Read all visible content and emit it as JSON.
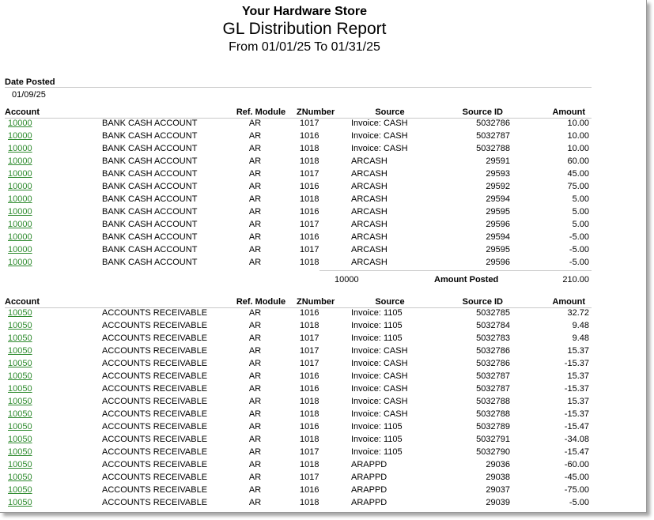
{
  "report": {
    "store_name": "Your Hardware Store",
    "title": "GL Distribution Report",
    "date_range": "From 01/01/25 To 01/31/25"
  },
  "date_posted": {
    "label": "Date Posted",
    "value": "01/09/25"
  },
  "columns": {
    "account": "Account",
    "ref_module": "Ref. Module",
    "znumber": "ZNumber",
    "source": "Source",
    "source_id": "Source ID",
    "amount": "Amount"
  },
  "sections": [
    {
      "rows": [
        {
          "account": "10000",
          "name": "BANK CASH ACCOUNT",
          "module": "AR",
          "znumber": "1017",
          "source": "Invoice: CASH",
          "source_id": "5032786",
          "amount": "10.00"
        },
        {
          "account": "10000",
          "name": "BANK CASH ACCOUNT",
          "module": "AR",
          "znumber": "1016",
          "source": "Invoice: CASH",
          "source_id": "5032787",
          "amount": "10.00"
        },
        {
          "account": "10000",
          "name": "BANK CASH ACCOUNT",
          "module": "AR",
          "znumber": "1018",
          "source": "Invoice: CASH",
          "source_id": "5032788",
          "amount": "10.00"
        },
        {
          "account": "10000",
          "name": "BANK CASH ACCOUNT",
          "module": "AR",
          "znumber": "1018",
          "source": "ARCASH",
          "source_id": "29591",
          "amount": "60.00"
        },
        {
          "account": "10000",
          "name": "BANK CASH ACCOUNT",
          "module": "AR",
          "znumber": "1017",
          "source": "ARCASH",
          "source_id": "29593",
          "amount": "45.00"
        },
        {
          "account": "10000",
          "name": "BANK CASH ACCOUNT",
          "module": "AR",
          "znumber": "1016",
          "source": "ARCASH",
          "source_id": "29592",
          "amount": "75.00"
        },
        {
          "account": "10000",
          "name": "BANK CASH ACCOUNT",
          "module": "AR",
          "znumber": "1018",
          "source": "ARCASH",
          "source_id": "29594",
          "amount": "5.00"
        },
        {
          "account": "10000",
          "name": "BANK CASH ACCOUNT",
          "module": "AR",
          "znumber": "1016",
          "source": "ARCASH",
          "source_id": "29595",
          "amount": "5.00"
        },
        {
          "account": "10000",
          "name": "BANK CASH ACCOUNT",
          "module": "AR",
          "znumber": "1017",
          "source": "ARCASH",
          "source_id": "29596",
          "amount": "5.00"
        },
        {
          "account": "10000",
          "name": "BANK CASH ACCOUNT",
          "module": "AR",
          "znumber": "1016",
          "source": "ARCASH",
          "source_id": "29594",
          "amount": "-5.00"
        },
        {
          "account": "10000",
          "name": "BANK CASH ACCOUNT",
          "module": "AR",
          "znumber": "1017",
          "source": "ARCASH",
          "source_id": "29595",
          "amount": "-5.00"
        },
        {
          "account": "10000",
          "name": "BANK CASH ACCOUNT",
          "module": "AR",
          "znumber": "1018",
          "source": "ARCASH",
          "source_id": "29596",
          "amount": "-5.00"
        }
      ],
      "summary": {
        "account": "10000",
        "label": "Amount Posted",
        "amount": "210.00"
      }
    },
    {
      "rows": [
        {
          "account": "10050",
          "name": "ACCOUNTS RECEIVABLE",
          "module": "AR",
          "znumber": "1016",
          "source": "Invoice: 1105",
          "source_id": "5032785",
          "amount": "32.72"
        },
        {
          "account": "10050",
          "name": "ACCOUNTS RECEIVABLE",
          "module": "AR",
          "znumber": "1018",
          "source": "Invoice: 1105",
          "source_id": "5032784",
          "amount": "9.48"
        },
        {
          "account": "10050",
          "name": "ACCOUNTS RECEIVABLE",
          "module": "AR",
          "znumber": "1017",
          "source": "Invoice: 1105",
          "source_id": "5032783",
          "amount": "9.48"
        },
        {
          "account": "10050",
          "name": "ACCOUNTS RECEIVABLE",
          "module": "AR",
          "znumber": "1017",
          "source": "Invoice: CASH",
          "source_id": "5032786",
          "amount": "15.37"
        },
        {
          "account": "10050",
          "name": "ACCOUNTS RECEIVABLE",
          "module": "AR",
          "znumber": "1017",
          "source": "Invoice: CASH",
          "source_id": "5032786",
          "amount": "-15.37"
        },
        {
          "account": "10050",
          "name": "ACCOUNTS RECEIVABLE",
          "module": "AR",
          "znumber": "1016",
          "source": "Invoice: CASH",
          "source_id": "5032787",
          "amount": "15.37"
        },
        {
          "account": "10050",
          "name": "ACCOUNTS RECEIVABLE",
          "module": "AR",
          "znumber": "1016",
          "source": "Invoice: CASH",
          "source_id": "5032787",
          "amount": "-15.37"
        },
        {
          "account": "10050",
          "name": "ACCOUNTS RECEIVABLE",
          "module": "AR",
          "znumber": "1018",
          "source": "Invoice: CASH",
          "source_id": "5032788",
          "amount": "15.37"
        },
        {
          "account": "10050",
          "name": "ACCOUNTS RECEIVABLE",
          "module": "AR",
          "znumber": "1018",
          "source": "Invoice: CASH",
          "source_id": "5032788",
          "amount": "-15.37"
        },
        {
          "account": "10050",
          "name": "ACCOUNTS RECEIVABLE",
          "module": "AR",
          "znumber": "1016",
          "source": "Invoice: 1105",
          "source_id": "5032789",
          "amount": "-15.47"
        },
        {
          "account": "10050",
          "name": "ACCOUNTS RECEIVABLE",
          "module": "AR",
          "znumber": "1018",
          "source": "Invoice: 1105",
          "source_id": "5032791",
          "amount": "-34.08"
        },
        {
          "account": "10050",
          "name": "ACCOUNTS RECEIVABLE",
          "module": "AR",
          "znumber": "1017",
          "source": "Invoice: 1105",
          "source_id": "5032790",
          "amount": "-15.47"
        },
        {
          "account": "10050",
          "name": "ACCOUNTS RECEIVABLE",
          "module": "AR",
          "znumber": "1018",
          "source": "ARAPPD",
          "source_id": "29036",
          "amount": "-60.00"
        },
        {
          "account": "10050",
          "name": "ACCOUNTS RECEIVABLE",
          "module": "AR",
          "znumber": "1017",
          "source": "ARAPPD",
          "source_id": "29038",
          "amount": "-45.00"
        },
        {
          "account": "10050",
          "name": "ACCOUNTS RECEIVABLE",
          "module": "AR",
          "znumber": "1016",
          "source": "ARAPPD",
          "source_id": "29037",
          "amount": "-75.00"
        },
        {
          "account": "10050",
          "name": "ACCOUNTS RECEIVABLE",
          "module": "AR",
          "znumber": "1018",
          "source": "ARAPPD",
          "source_id": "29039",
          "amount": "-5.00"
        }
      ]
    }
  ]
}
